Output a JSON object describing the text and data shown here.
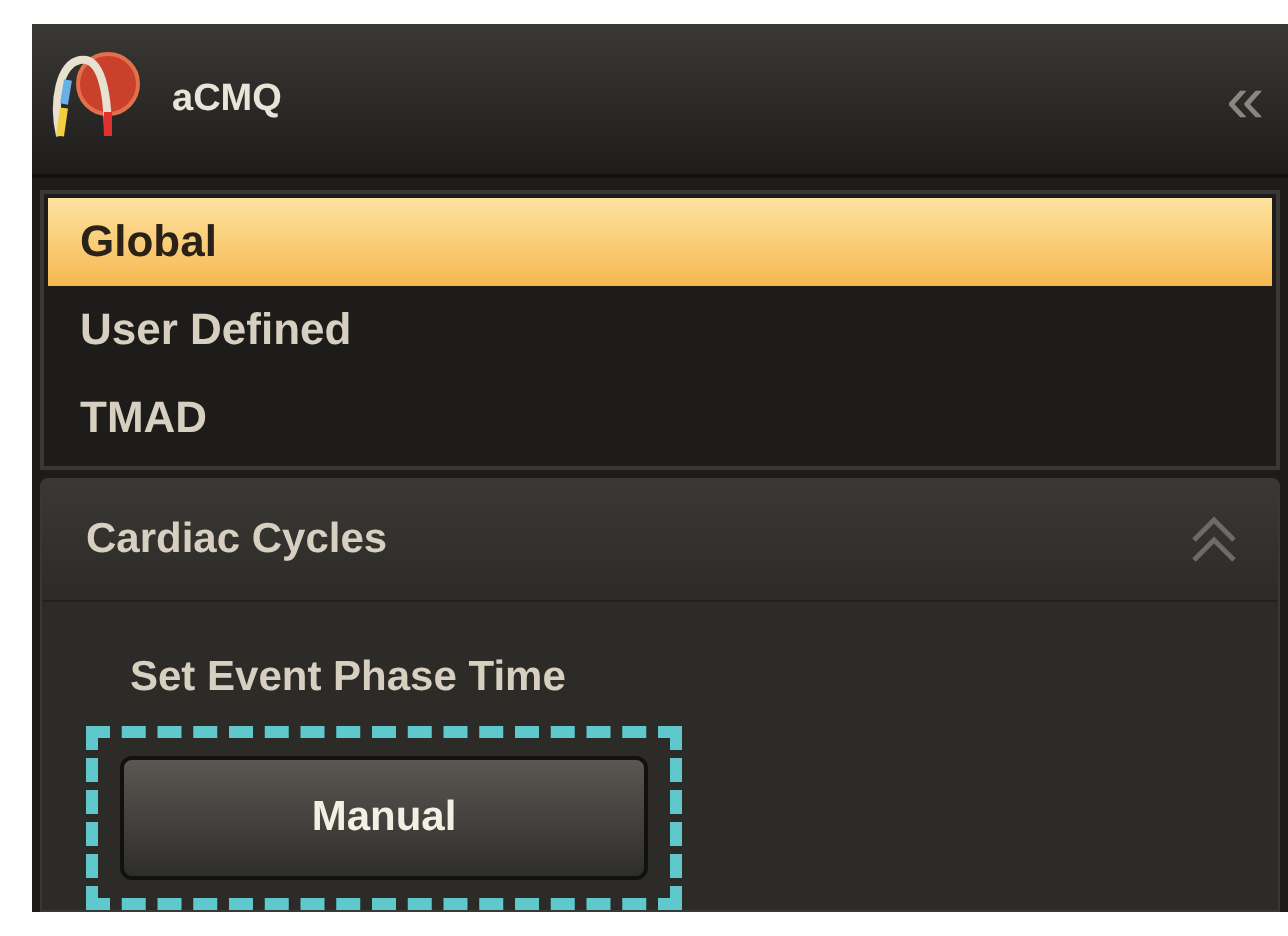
{
  "header": {
    "title": "aCMQ",
    "collapse_glyph": "«"
  },
  "list": [
    {
      "label": "Global",
      "selected": true
    },
    {
      "label": "User Defined",
      "selected": false
    },
    {
      "label": "TMAD",
      "selected": false
    }
  ],
  "section": {
    "title": "Cardiac Cycles",
    "expanded": true,
    "field_label": "Set Event Phase Time",
    "button": {
      "label": "Manual",
      "highlighted": true
    }
  }
}
